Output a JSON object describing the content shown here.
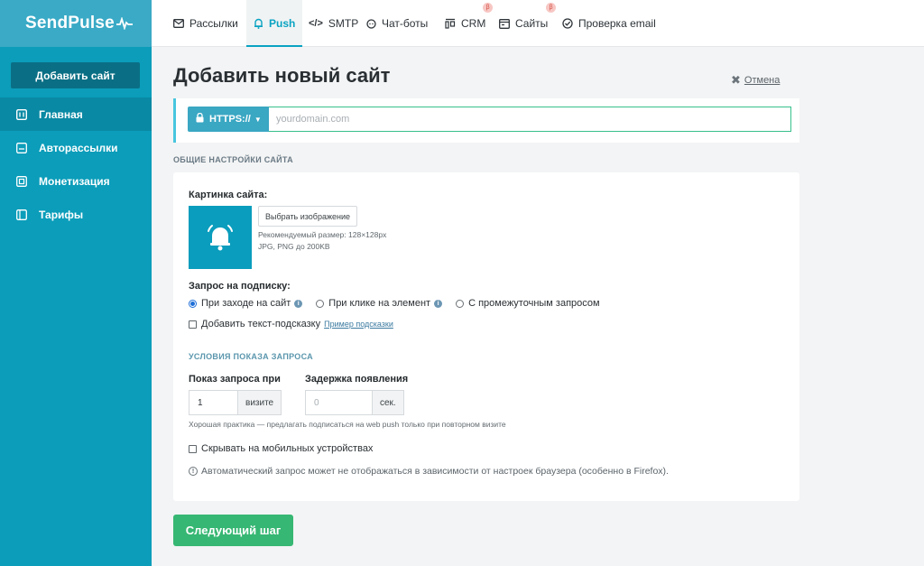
{
  "brand": {
    "name": "SendPulse"
  },
  "sidebar": {
    "add_site": "Добавить сайт",
    "items": [
      {
        "label": "Главная",
        "icon": "home-icon"
      },
      {
        "label": "Авторассылки",
        "icon": "automation-icon"
      },
      {
        "label": "Монетизация",
        "icon": "monetization-icon"
      },
      {
        "label": "Тарифы",
        "icon": "tariff-icon"
      }
    ]
  },
  "topnav": {
    "tabs": [
      {
        "label": "Рассылки",
        "icon": "mail-icon"
      },
      {
        "label": "Push",
        "icon": "bell-icon"
      },
      {
        "label": "SMTP",
        "icon": "code-icon"
      },
      {
        "label": "Чат-боты",
        "icon": "chat-icon"
      },
      {
        "label": "CRM",
        "icon": "crm-icon",
        "badge": "β"
      },
      {
        "label": "Сайты",
        "icon": "site-icon",
        "badge": "β"
      },
      {
        "label": "Проверка email",
        "icon": "check-icon"
      }
    ]
  },
  "page": {
    "title": "Добавить новый сайт",
    "cancel": "Отмена",
    "protocol": "HTTPS://",
    "domain_placeholder": "yourdomain.com",
    "section_general": "ОБЩИЕ НАСТРОЙКИ САЙТА"
  },
  "image": {
    "label": "Картинка сайта:",
    "choose": "Выбрать изображение",
    "recommended": "Рекомендуемый размер: 128×128px",
    "formats": "JPG, PNG до 200KB"
  },
  "subscribe": {
    "label": "Запрос на подписку:",
    "options": [
      {
        "label": "При заходе на сайт",
        "checked": true,
        "info": true
      },
      {
        "label": "При клике на элемент",
        "checked": false,
        "info": true
      },
      {
        "label": "С промежуточным запросом",
        "checked": false,
        "info": false
      }
    ],
    "hint_checkbox": "Добавить текст-подсказку",
    "hint_example": "Пример подсказки"
  },
  "conditions": {
    "label": "УСЛОВИЯ ПОКАЗА ЗАПРОСА",
    "show_label": "Показ запроса при",
    "show_value": "1",
    "show_unit": "визите",
    "delay_label": "Задержка появления",
    "delay_placeholder": "0",
    "delay_unit": "сек.",
    "hint": "Хорошая практика — предлагать подписаться на web push только при повторном визите",
    "mobile": "Скрывать на мобильных устройствах",
    "note": "Автоматический запрос может не отображаться в зависимости от настроек браузера (особенно в Firefox)."
  },
  "next_button": "Следующий шаг",
  "colors": {
    "sidebar": "#0b9dba",
    "accent": "#0aa3c2",
    "green": "#36b773"
  }
}
